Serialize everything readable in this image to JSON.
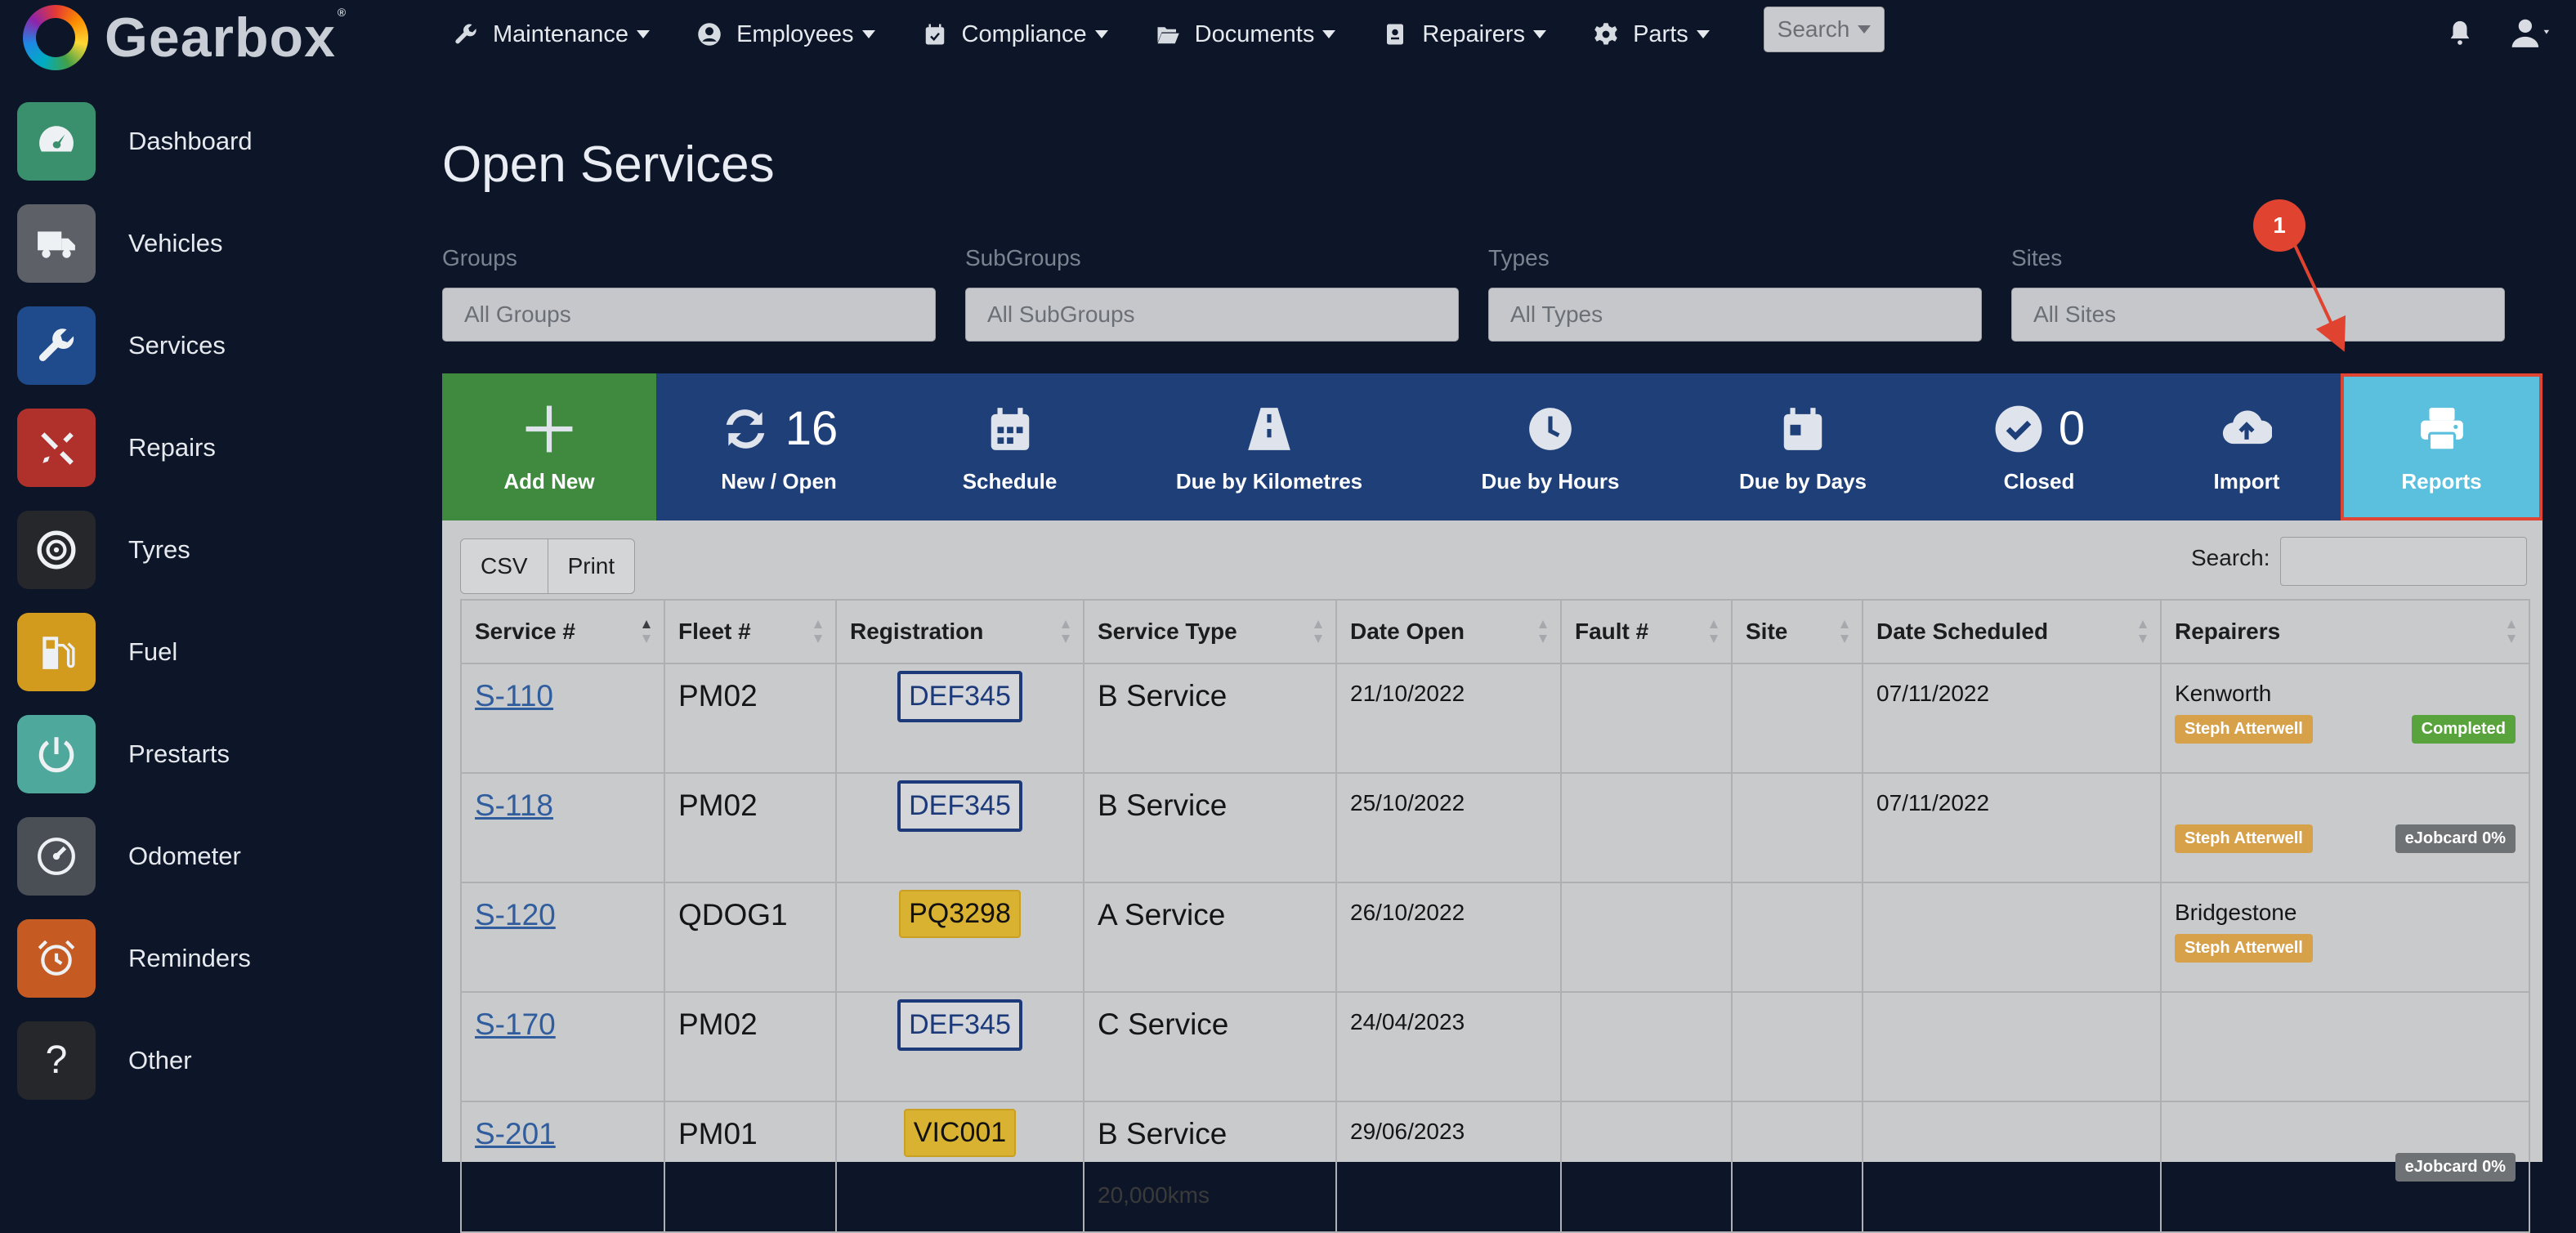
{
  "brand": {
    "name": "Gearbox"
  },
  "topnav": [
    {
      "label": "Maintenance",
      "icon": "wrench-icon"
    },
    {
      "label": "Employees",
      "icon": "user-circle-icon"
    },
    {
      "label": "Compliance",
      "icon": "calendar-check-icon"
    },
    {
      "label": "Documents",
      "icon": "folder-open-icon"
    },
    {
      "label": "Repairers",
      "icon": "address-book-icon"
    },
    {
      "label": "Parts",
      "icon": "gear-icon"
    }
  ],
  "search_button": "Search",
  "sidebar": [
    {
      "label": "Dashboard",
      "color": "#3a8f6c"
    },
    {
      "label": "Vehicles",
      "color": "#5d6167"
    },
    {
      "label": "Services",
      "color": "#1f4a8b"
    },
    {
      "label": "Repairs",
      "color": "#b0302c"
    },
    {
      "label": "Tyres",
      "color": "#25272b"
    },
    {
      "label": "Fuel",
      "color": "#d39b1d"
    },
    {
      "label": "Prestarts",
      "color": "#4fa89c"
    },
    {
      "label": "Odometer",
      "color": "#4a4e55"
    },
    {
      "label": "Reminders",
      "color": "#c55a22"
    },
    {
      "label": "Other",
      "color": "#25272b"
    }
  ],
  "page": {
    "title": "Open Services"
  },
  "filters": [
    {
      "label": "Groups",
      "placeholder": "All Groups"
    },
    {
      "label": "SubGroups",
      "placeholder": "All SubGroups"
    },
    {
      "label": "Types",
      "placeholder": "All Types"
    },
    {
      "label": "Sites",
      "placeholder": "All Sites"
    }
  ],
  "toolbar": {
    "add_new": "Add New",
    "new_open": {
      "label": "New / Open",
      "count": "16"
    },
    "schedule": "Schedule",
    "due_km": "Due by Kilometres",
    "due_hours": "Due by Hours",
    "due_days": "Due by Days",
    "closed": {
      "label": "Closed",
      "count": "0"
    },
    "import": "Import",
    "reports": "Reports"
  },
  "table_tools": {
    "csv": "CSV",
    "print": "Print",
    "search_label": "Search:"
  },
  "columns": [
    "Service #",
    "Fleet #",
    "Registration",
    "Service Type",
    "Date Open",
    "Fault #",
    "Site",
    "Date Scheduled",
    "Repairers"
  ],
  "rows": [
    {
      "service": "S-110",
      "fleet": "PM02",
      "reg": "DEF345",
      "reg_style": "blue",
      "type": "B Service",
      "kms": "",
      "date_open": "21/10/2022",
      "fault": "",
      "site": "",
      "scheduled": "07/11/2022",
      "repairer": "Kenworth",
      "person": "Steph Atterwell",
      "status": "Completed",
      "status_style": "green"
    },
    {
      "service": "S-118",
      "fleet": "PM02",
      "reg": "DEF345",
      "reg_style": "blue",
      "type": "B Service",
      "kms": "",
      "date_open": "25/10/2022",
      "fault": "",
      "site": "",
      "scheduled": "07/11/2022",
      "repairer": "",
      "person": "Steph Atterwell",
      "status": "eJobcard 0%",
      "status_style": "grey"
    },
    {
      "service": "S-120",
      "fleet": "QDOG1",
      "reg": "PQ3298",
      "reg_style": "yellow",
      "type": "A Service",
      "kms": "",
      "date_open": "26/10/2022",
      "fault": "",
      "site": "",
      "scheduled": "",
      "repairer": "Bridgestone",
      "person": "Steph Atterwell",
      "status": "",
      "status_style": ""
    },
    {
      "service": "S-170",
      "fleet": "PM02",
      "reg": "DEF345",
      "reg_style": "blue",
      "type": "C Service",
      "kms": "",
      "date_open": "24/04/2023",
      "fault": "",
      "site": "",
      "scheduled": "",
      "repairer": "",
      "person": "",
      "status": "",
      "status_style": ""
    },
    {
      "service": "S-201",
      "fleet": "PM01",
      "reg": "VIC001",
      "reg_style": "yellow",
      "type": "B Service",
      "kms": "20,000kms",
      "date_open": "29/06/2023",
      "fault": "",
      "site": "",
      "scheduled": "",
      "repairer": "",
      "person": "",
      "status": "eJobcard 0%",
      "status_style": "grey"
    }
  ],
  "annotation": {
    "step": "1"
  },
  "colors": {
    "accent": "#5bc0de",
    "toolbar": "#1f3f79",
    "add": "#3f8a3f",
    "highlight": "#e04433"
  }
}
